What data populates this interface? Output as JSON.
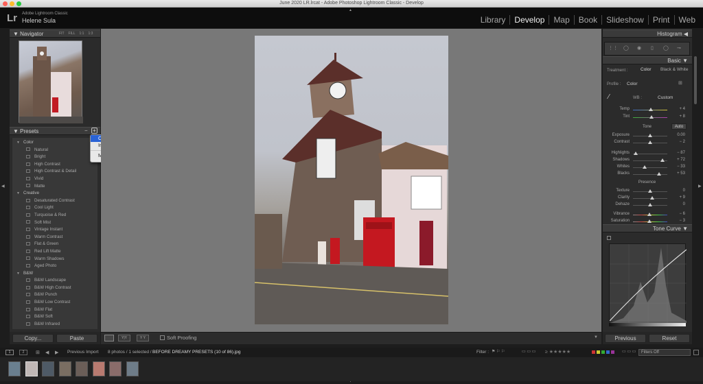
{
  "window": {
    "title": "June 2020 LR.lrcat - Adobe Photoshop Lightroom Classic - Develop"
  },
  "identity": {
    "app": "Adobe Lightroom Classic",
    "user": "Helene Sula",
    "logo": "Lr"
  },
  "modules": [
    "Library",
    "Develop",
    "Map",
    "Book",
    "Slideshow",
    "Print",
    "Web"
  ],
  "active_module": "Develop",
  "navigator": {
    "title": "Navigator",
    "zoom_options": [
      "FIT",
      "FILL",
      "1:1",
      "1:3"
    ]
  },
  "presets": {
    "title": "Presets",
    "groups": [
      {
        "name": "Color",
        "items": [
          "Natural",
          "Bright",
          "High Contrast",
          "High Contrast & Detail",
          "Vivid",
          "Matte"
        ]
      },
      {
        "name": "Creative",
        "items": [
          "Desaturated Contrast",
          "Cool Light",
          "Turquoise & Red",
          "Soft Mist",
          "Vintage Instant",
          "Warm Contrast",
          "Flat & Green",
          "Red Lift Matte",
          "Warm Shadows",
          "Aged Photo"
        ]
      },
      {
        "name": "B&W",
        "items": [
          "B&W Landscape",
          "B&W High Contrast",
          "B&W Punch",
          "B&W Low Contrast",
          "B&W Flat",
          "B&W Soft",
          "B&W Infrared"
        ]
      }
    ]
  },
  "context_menu": {
    "items": [
      "Create Preset...",
      "Import Presets...",
      "Manage Presets..."
    ],
    "selected": "Create Preset..."
  },
  "left_buttons": {
    "copy": "Copy...",
    "paste": "Paste"
  },
  "toolbar": {
    "soft_proofing": "Soft Proofing"
  },
  "histogram": {
    "title": "Histogram"
  },
  "basic": {
    "title": "Basic",
    "treatment_label": "Treatment :",
    "treatment_color": "Color",
    "treatment_bw": "Black & White",
    "profile_label": "Profile :",
    "profile_value": "Color",
    "wb_label": "WB :",
    "wb_value": "Custom",
    "tone_label": "Tone",
    "auto_label": "Auto",
    "presence_label": "Presence",
    "sliders": [
      {
        "label": "Temp",
        "value": "+ 4",
        "pos": 0.52
      },
      {
        "label": "Tint",
        "value": "+ 8",
        "pos": 0.54
      },
      {
        "label": "Exposure",
        "value": "0.00",
        "pos": 0.5
      },
      {
        "label": "Contrast",
        "value": "− 2",
        "pos": 0.49
      },
      {
        "label": "Highlights",
        "value": "− 87",
        "pos": 0.07
      },
      {
        "label": "Shadows",
        "value": "+ 72",
        "pos": 0.86
      },
      {
        "label": "Whites",
        "value": "− 33",
        "pos": 0.33
      },
      {
        "label": "Blacks",
        "value": "+ 53",
        "pos": 0.76
      },
      {
        "label": "Texture",
        "value": "0",
        "pos": 0.5
      },
      {
        "label": "Clarity",
        "value": "+ 9",
        "pos": 0.55
      },
      {
        "label": "Dehaze",
        "value": "0",
        "pos": 0.5
      },
      {
        "label": "Vibrance",
        "value": "− 6",
        "pos": 0.47
      },
      {
        "label": "Saturation",
        "value": "− 3",
        "pos": 0.48
      }
    ]
  },
  "tone_curve": {
    "title": "Tone Curve"
  },
  "right_buttons": {
    "previous": "Previous",
    "reset": "Reset"
  },
  "filmstrip": {
    "source": "Previous Import",
    "info": "8 photos / 1 selected /",
    "filename": "BEFORE DREAMY PRESETS (10 of 86).jpg",
    "filter_label": "Filter :",
    "filters_off": "Filters Off",
    "page_numbers": [
      "1",
      "2"
    ]
  }
}
